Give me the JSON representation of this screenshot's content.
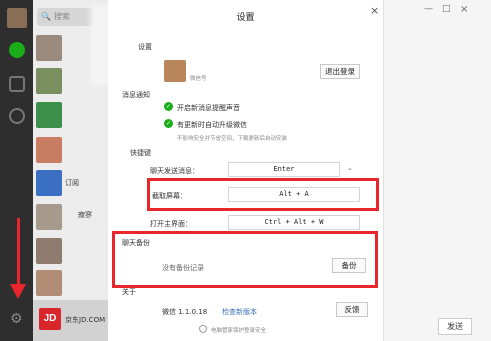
{
  "chat_list": {
    "search_placeholder": "搜索",
    "item_labels": [
      "订阅",
      "寂寥"
    ],
    "jd_logo": "JD",
    "jd_text": "京东JD.COM"
  },
  "background_window": {
    "send_label": "发送",
    "minimize": "—",
    "maximize": "□"
  },
  "dialog": {
    "title": "设置",
    "close": "×",
    "sections": {
      "account": "设置",
      "notifications": "消息通知",
      "shortcuts": "快捷键",
      "backup": "聊天备份",
      "about": "关于"
    },
    "account": {
      "nickname": "微信号",
      "logout_label": "退出登录"
    },
    "notifications": {
      "new_message_sound": "开启新消息提醒声音",
      "auto_upgrade": "有更新时自动升级微信",
      "hint": "不影响安全并节省空间，下载更新后自动安装"
    },
    "shortcuts": {
      "send_label": "聊天发送消息：",
      "send_value": "Enter",
      "screenshot_label": "截取屏幕：",
      "screenshot_value": "Alt + A",
      "open_main_label": "打开主界面：",
      "open_main_value": "Ctrl + Alt + W"
    },
    "backup": {
      "status": "没有备份记录",
      "backup_button": "备份"
    },
    "about": {
      "version": "微信 1.1.0.18",
      "check_update": "检查新版本",
      "feedback_button": "反馈"
    },
    "footer": "电脑管家保护登录安全"
  },
  "accent_colors": {
    "highlight_red": "#e8262b",
    "wechat_green": "#1aad19"
  }
}
